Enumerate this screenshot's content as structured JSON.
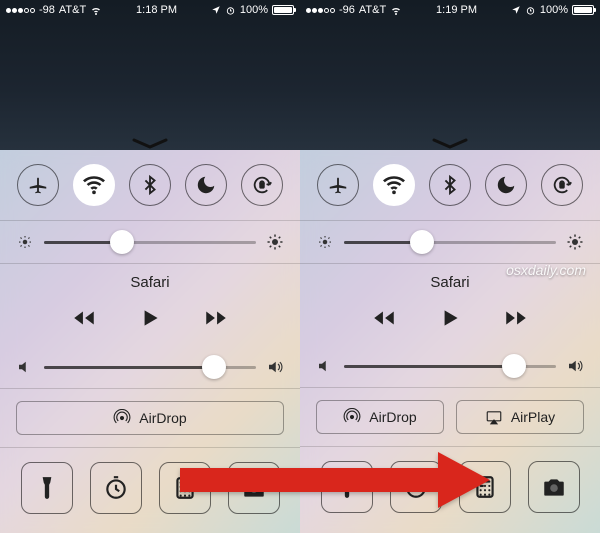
{
  "status_left": {
    "signal": "-98",
    "carrier": "AT&T",
    "time": "1:18 PM",
    "battery": "100%"
  },
  "status_right": {
    "signal": "-96",
    "carrier": "AT&T",
    "time": "1:19 PM",
    "battery": "100%"
  },
  "control_center": {
    "now_playing": "Safari",
    "airdrop_label": "AirDrop",
    "airplay_label": "AirPlay",
    "brightness_pct": 37,
    "volume_pct": 80,
    "toggles": {
      "airplane": false,
      "wifi": true,
      "bluetooth": false,
      "dnd": false,
      "rotation_lock": false
    }
  },
  "watermark": "osxdaily.com"
}
